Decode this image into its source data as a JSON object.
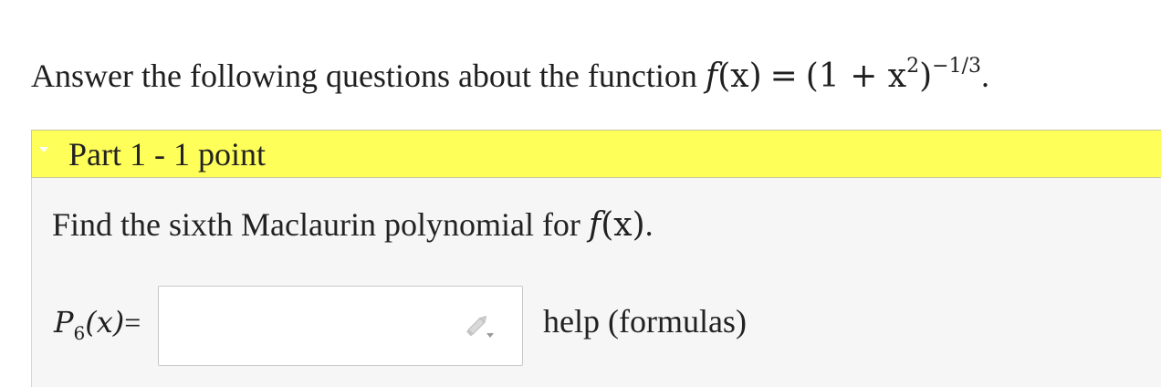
{
  "intro": {
    "text": "Answer the following questions about the function",
    "func_name": "f",
    "func_arg": "(x)",
    "equals": "=",
    "base": "(1 + x",
    "base_exp": "2",
    "base_close": ")",
    "outer_exp": "−1/3",
    "period": "."
  },
  "part": {
    "title": "Part 1 - 1 point",
    "question_text": "Find the sixth Maclaurin polynomial for",
    "question_func_name": "f",
    "question_func_arg": "(x)",
    "question_period": ".",
    "answer_label_P": "P",
    "answer_label_sub": "6",
    "answer_label_arg": "(x)",
    "answer_label_eq": "=",
    "answer_value": "",
    "answer_placeholder": "",
    "help_text": "help (formulas)"
  },
  "colors": {
    "header_background": "#ffff5a",
    "body_background": "#f6f6f6"
  },
  "icons": {
    "toggle": "caret-down-icon",
    "editor": "pencil-icon"
  }
}
